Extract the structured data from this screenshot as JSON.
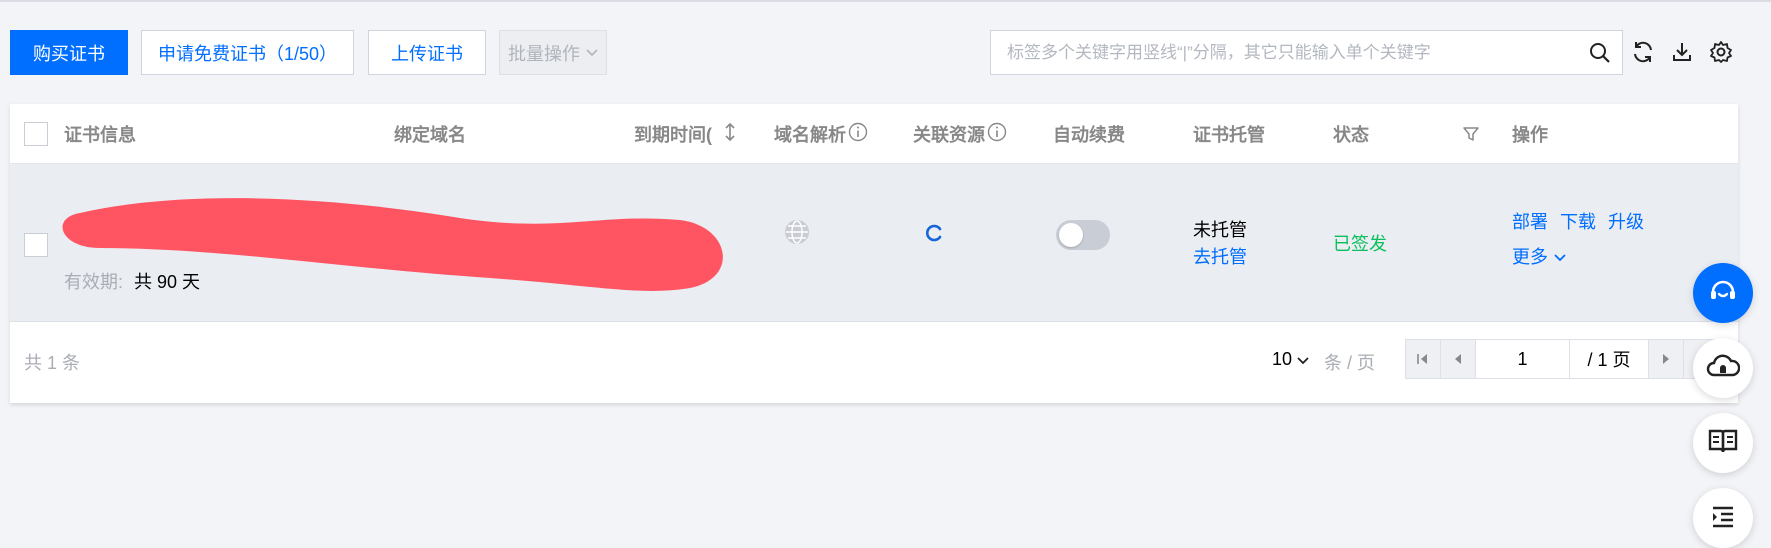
{
  "toolbar": {
    "buy_label": "购买证书",
    "free_label": "申请免费证书（1/50）",
    "upload_label": "上传证书",
    "batch_label": "批量操作",
    "search_placeholder": "标签多个关键字用竖线“|”分隔，其它只能输入单个关键字"
  },
  "table": {
    "headers": {
      "cert_info": "证书信息",
      "domain": "绑定域名",
      "expire": "到期时间(",
      "dns": "域名解析",
      "resources": "关联资源",
      "auto_renew": "自动续费",
      "hosting": "证书托管",
      "status": "状态",
      "actions": "操作"
    },
    "rows": [
      {
        "validity_label": "有效期:",
        "validity_value": "共 90 天",
        "hosting_status": "未托管",
        "hosting_link": "去托管",
        "status": "已签发",
        "action_deploy": "部署",
        "action_download": "下载",
        "action_upgrade": "升级",
        "action_more": "更多"
      }
    ]
  },
  "footer": {
    "total_text": "共 1 条",
    "page_size": "10",
    "per_page_label": "条 / 页",
    "current_page": "1",
    "total_pages": "/ 1 页"
  },
  "colors": {
    "primary": "#006eff",
    "status_green": "#0abf5b",
    "redaction": "#ff5563"
  }
}
